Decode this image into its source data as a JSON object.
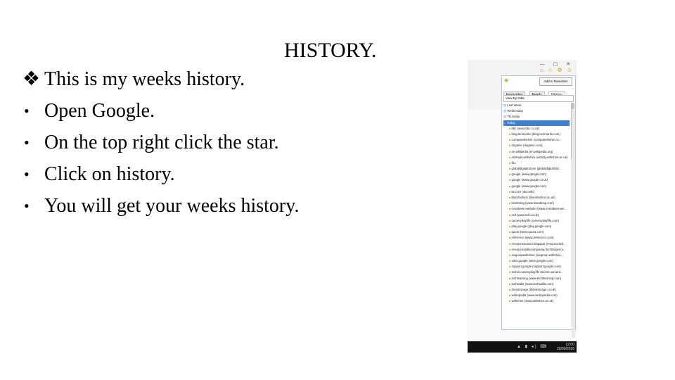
{
  "slide": {
    "title": "HISTORY.",
    "intro": "This is my weeks history.",
    "steps": [
      "Open Google.",
      "On the top right click the star.",
      "Click on history.",
      "You will get your weeks history."
    ],
    "intro_marker": "❖",
    "step_marker": "•"
  },
  "screenshot": {
    "add_button": "Add to favourites",
    "tabs": [
      "Favourites",
      "Feeds",
      "History"
    ],
    "view_select": "View By Date",
    "folders": [
      "Last Week",
      "Wednesday",
      "Thursday",
      "Today"
    ],
    "sites": [
      "bbc (www.bbc.co.uk)",
      "blog.tectmarks (blog.tectmarks.com)",
      "computeshelvin (computeshelve.co...",
      "dogtime (dogtime.com)",
      "en.wikipedia (en.wikipedia.org)",
      "eststudy.withshire (estudy.withshire.ac.uk)",
      "fb1",
      "globaldigitalcitizen (globaldigitalcitiz...",
      "google (www.google.com)",
      "google (www.google.co.uk)",
      "google (www.google.com)",
      "ks.com (ukcontk)",
      "lilacsfashion (lilacsfashion.ac.uk)",
      "lisenbring (www.lisenbring.com)",
      "mortaleen-webster (www.mortaleen-we...",
      "ncll (www.ncll.co.uk)",
      "ourverydayfife (ourverydayfife.com)",
      "play.google (play.google.com)",
      "quora (www.quora.com)",
      "reference (www.reference.com)",
      "resourcesesseo.blogspot (resourcessb...",
      "resourcesablecomputing (techtarget (s...",
      "sixgroupwithshire (sixgroup.withshire...",
      "sites.google (sites.google.com)",
      "support.google (support.google.com)",
      "techin.ourverydayfife (techin.ourvera...",
      "techlearning (www.techlearning.com)",
      "techwalla (www.techwalla.com)",
      "thestretcage (thestretcage.co.uk)",
      "webopedia (www.webopedia.com)",
      "withshire (www.withshire.ac.uk)"
    ],
    "window_buttons": "— ▢ ✕",
    "toolbar_icons": "⌂ ☆ ⚙ ☺",
    "tray_icons": "▲ ▮ ◂) ⌨",
    "clock_time": "12:00",
    "clock_date": "20/09/2016"
  }
}
